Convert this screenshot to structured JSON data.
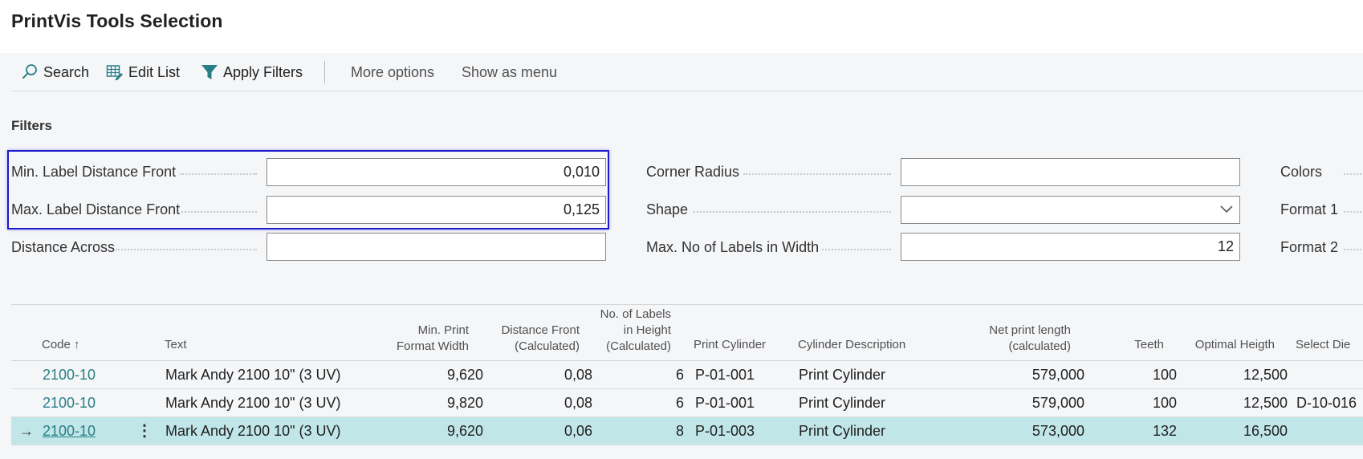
{
  "page": {
    "title": "PrintVis Tools Selection"
  },
  "actions": {
    "search": "Search",
    "edit_list": "Edit List",
    "apply_filters": "Apply Filters",
    "more_options": "More options",
    "show_as_menu": "Show as menu"
  },
  "filters": {
    "heading": "Filters",
    "min_label_distance_front": {
      "label": "Min. Label Distance Front",
      "value": "0,010"
    },
    "max_label_distance_front": {
      "label": "Max. Label Distance Front",
      "value": "0,125"
    },
    "distance_across": {
      "label": "Distance Across",
      "value": ""
    },
    "corner_radius": {
      "label": "Corner Radius",
      "value": ""
    },
    "shape": {
      "label": "Shape",
      "value": ""
    },
    "max_labels_in_width": {
      "label": "Max. No of Labels in Width",
      "value": "12"
    },
    "colors": {
      "label": "Colors"
    },
    "format_1": {
      "label": "Format 1"
    },
    "format_2": {
      "label": "Format 2"
    }
  },
  "table": {
    "columns": {
      "code": "Code",
      "code_sort": "↑",
      "text": "Text",
      "min_print_1": "Min. Print",
      "min_print_2": "Format Width",
      "dist_front_1": "Distance Front",
      "dist_front_2": "(Calculated)",
      "labels_h_1": "No. of Labels",
      "labels_h_2": "in Height",
      "labels_h_3": "(Calculated)",
      "print_cylinder": "Print Cylinder",
      "cylinder_description": "Cylinder Description",
      "net_print_1": "Net print length",
      "net_print_2": "(calculated)",
      "teeth": "Teeth",
      "optimal_height": "Optimal Heigth",
      "select_die": "Select Die"
    },
    "rows": [
      {
        "code": "2100-10",
        "text": "Mark Andy 2100 10\" (3 UV)",
        "min_print": "9,620",
        "dist_front": "0,08",
        "labels_h": "6",
        "print_cylinder": "P-01-001",
        "cylinder_description": "Print Cylinder",
        "net_print": "579,000",
        "teeth": "100",
        "optimal_height": "12,500",
        "select_die": ""
      },
      {
        "code": "2100-10",
        "text": "Mark Andy 2100 10\" (3 UV)",
        "min_print": "9,820",
        "dist_front": "0,08",
        "labels_h": "6",
        "print_cylinder": "P-01-001",
        "cylinder_description": "Print Cylinder",
        "net_print": "579,000",
        "teeth": "100",
        "optimal_height": "12,500",
        "select_die": "D-10-016"
      },
      {
        "code": "2100-10",
        "text": "Mark Andy 2100 10\" (3 UV)",
        "min_print": "9,620",
        "dist_front": "0,06",
        "labels_h": "8",
        "print_cylinder": "P-01-003",
        "cylinder_description": "Print Cylinder",
        "net_print": "573,000",
        "teeth": "132",
        "optimal_height": "16,500",
        "select_die": "",
        "arrow": "→",
        "menu": "⋮"
      }
    ]
  },
  "colors": {
    "accent": "#287f86",
    "selected_row": "#c1e6e8",
    "highlight_border": "#1a1acc"
  }
}
